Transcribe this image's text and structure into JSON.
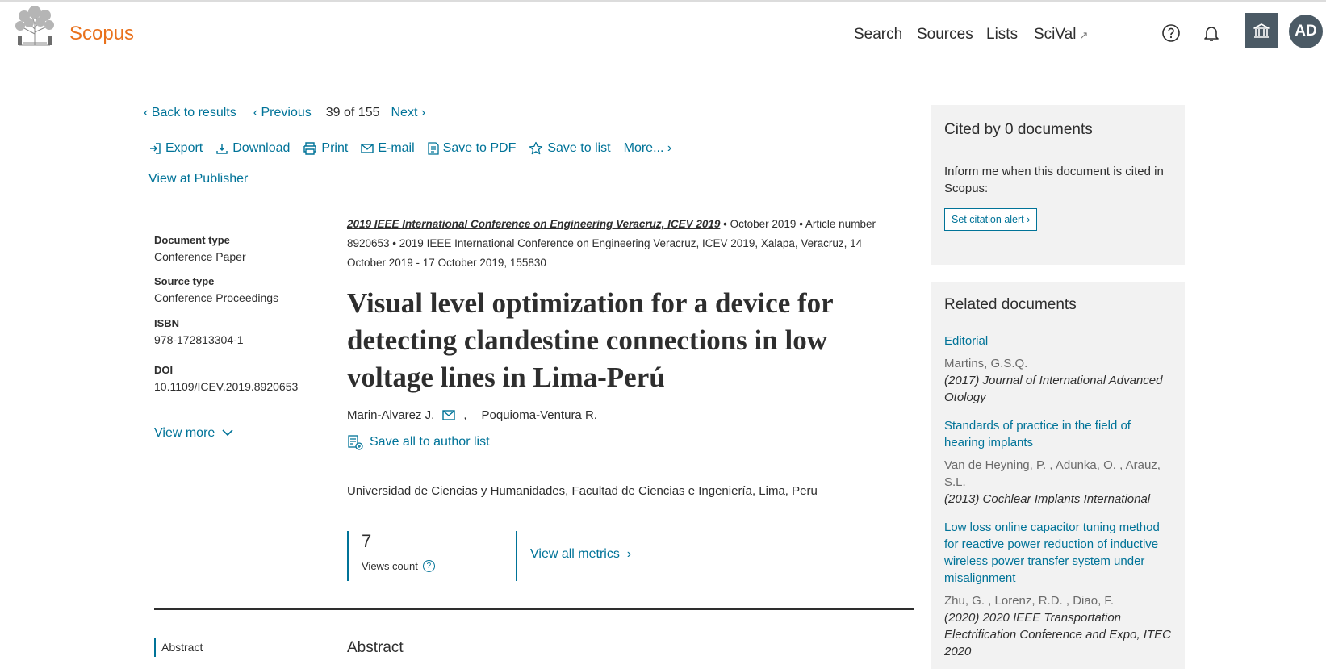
{
  "header": {
    "brand": "Scopus",
    "nav": {
      "search": "Search",
      "sources": "Sources",
      "lists": "Lists",
      "scival": "SciVal",
      "scival_arrow": "↗"
    },
    "avatar_initials": "AD",
    "icons": [
      "elsevier-tree-logo",
      "help-icon",
      "bell-icon",
      "institution-icon"
    ]
  },
  "result_nav": {
    "back": "Back to results",
    "previous": "Previous",
    "position": "39",
    "of": "of",
    "total": "155",
    "next": "Next"
  },
  "actions": {
    "export": "Export",
    "download": "Download",
    "print": "Print",
    "email": "E-mail",
    "save_pdf": "Save to PDF",
    "save_list": "Save to list",
    "more": "More...",
    "view_publisher": "View at Publisher"
  },
  "metadata": {
    "doc_type_label": "Document type",
    "doc_type_value": "Conference Paper",
    "source_type_label": "Source type",
    "source_type_value": "Conference Proceedings",
    "isbn_label": "ISBN",
    "isbn_value": "978-172813304-1",
    "doi_label": "DOI",
    "doi_value": "10.1109/ICEV.2019.8920653",
    "view_more": "View more"
  },
  "document": {
    "source_title": "2019 IEEE International Conference on Engineering Veracruz, ICEV 2019",
    "source_rest": " • October 2019 • Article number 8920653 • 2019 IEEE International Conference on Engineering Veracruz, ICEV 2019, Xalapa, Veracruz, 14 October 2019 - 17 October 2019, 155830",
    "title": "Visual level optimization for a device for detecting clandestine connections in low voltage lines in Lima-Perú",
    "author1": "Marin-Alvarez J.",
    "author2": "Poquioma-Ventura R.",
    "comma": ",",
    "save_authors": "Save all to author list",
    "affiliation": "Universidad de Ciencias y Humanidades, Facultad de Ciencias e Ingeniería, Lima, Peru"
  },
  "metrics": {
    "views": "7",
    "views_label": "Views count",
    "help_glyph": "?",
    "view_all": "View all metrics"
  },
  "abstract": {
    "side_label": "Abstract",
    "heading": "Abstract"
  },
  "cited": {
    "title": "Cited by 0 documents",
    "text": "Inform me when this document is cited in Scopus:",
    "button": "Set citation alert"
  },
  "related": {
    "title": "Related documents",
    "items": [
      {
        "title": "Editorial",
        "authors": "Martins, G.S.Q.",
        "source": "(2017) Journal of International Advanced Otology"
      },
      {
        "title": "Standards of practice in the field of hearing implants",
        "authors": "Van de Heyning, P. , Adunka, O. , Arauz, S.L.",
        "source": "(2013) Cochlear Implants International"
      },
      {
        "title": "Low loss online capacitor tuning method for reactive power reduction of inductive wireless power transfer system under misalignment",
        "authors": "Zhu, G. , Lorenz, R.D. , Diao, F.",
        "source": "(2020) 2020 IEEE Transportation Electrification Conference and Expo, ITEC 2020"
      }
    ]
  },
  "colors": {
    "brand_orange": "#e9711c",
    "link_blue": "#007398",
    "panel_gray": "#f2f2f2",
    "dark_slate": "#4b5a65"
  }
}
